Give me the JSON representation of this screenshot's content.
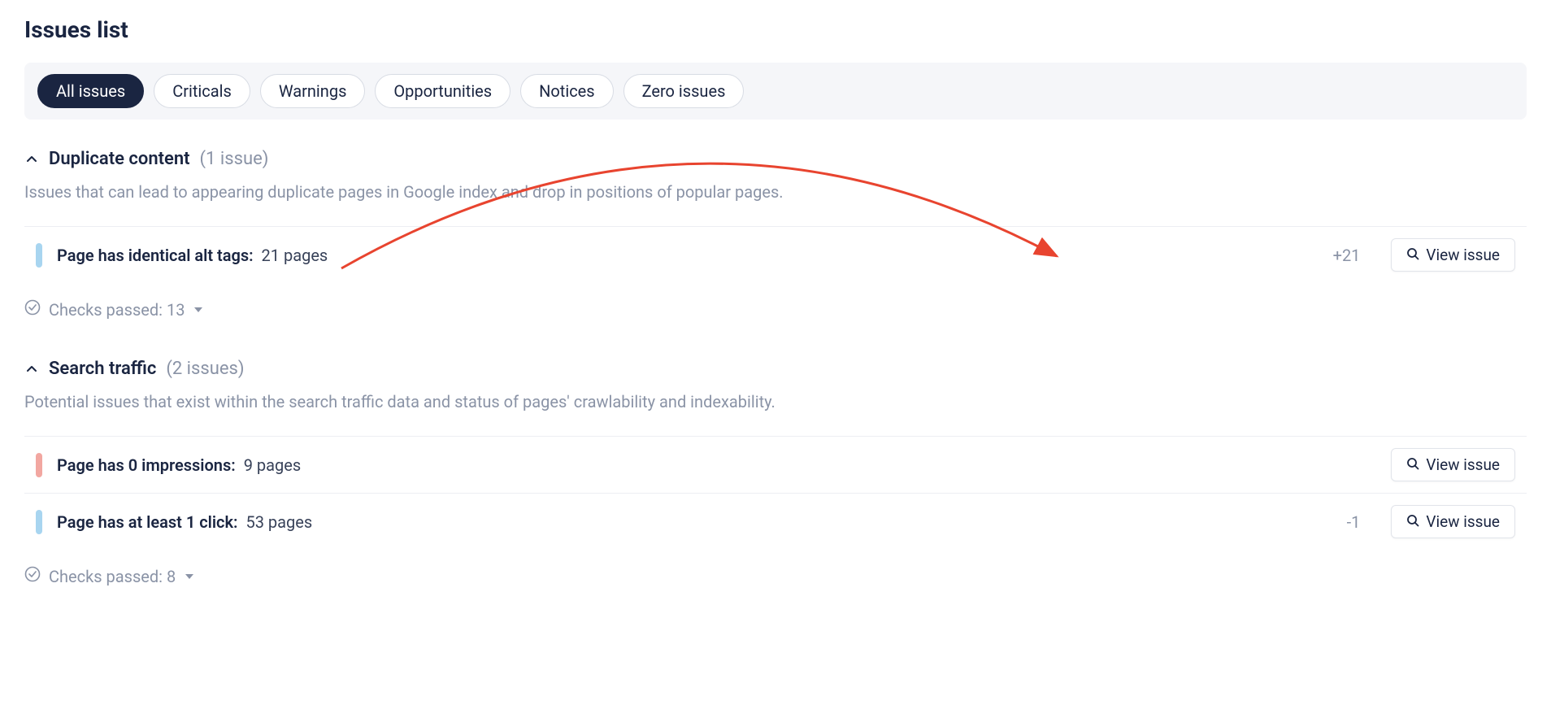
{
  "page_title": "Issues list",
  "filters": {
    "all_issues": "All issues",
    "criticals": "Criticals",
    "warnings": "Warnings",
    "opportunities": "Opportunities",
    "notices": "Notices",
    "zero_issues": "Zero issues"
  },
  "sections": {
    "duplicate": {
      "title": "Duplicate content",
      "count_label": "(1 issue)",
      "description": "Issues that can lead to appearing duplicate pages in Google index and drop in positions of popular pages.",
      "checks_passed": "Checks passed: 13",
      "items": {
        "0": {
          "title": "Page has identical alt tags:",
          "pages": "21 pages",
          "delta": "+21",
          "severity": "blue"
        }
      }
    },
    "search_traffic": {
      "title": "Search traffic",
      "count_label": "(2 issues)",
      "description": "Potential issues that exist within the search traffic data and status of pages' crawlability and indexability.",
      "checks_passed": "Checks passed: 8",
      "items": {
        "0": {
          "title": "Page has 0 impressions:",
          "pages": "9 pages",
          "delta": "",
          "severity": "red"
        },
        "1": {
          "title": "Page has at least 1 click:",
          "pages": "53 pages",
          "delta": "-1",
          "severity": "blue"
        }
      }
    }
  },
  "buttons": {
    "view_issue": "View issue"
  }
}
